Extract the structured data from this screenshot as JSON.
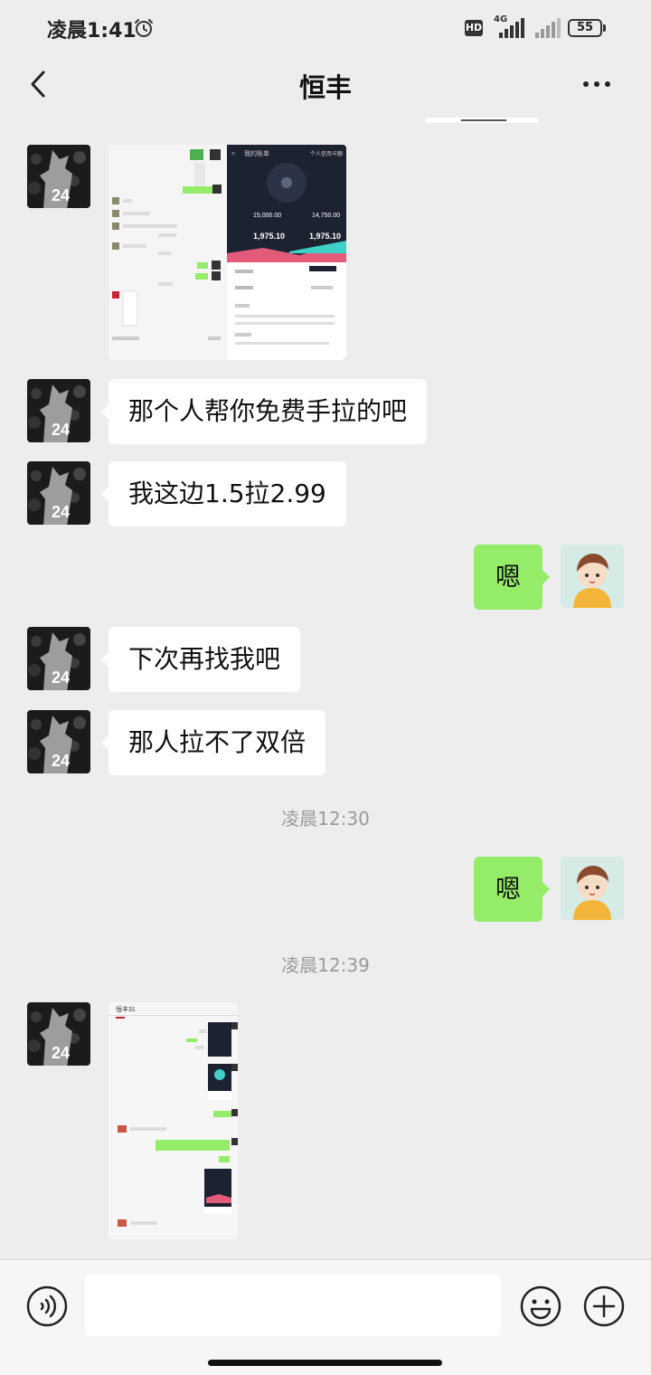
{
  "status_bar": {
    "time": "凌晨1:41",
    "hd": "HD",
    "network": "4G",
    "battery": "55"
  },
  "chat": {
    "title": "恒丰"
  },
  "messages": {
    "m2": "那个人帮你免费手拉的吧",
    "m3": "我这边1.5拉2.99",
    "m4": "嗯",
    "m5": "下次再找我吧",
    "m6": "那人拉不了双倍",
    "t1": "凌晨12:30",
    "m7": "嗯",
    "t2": "凌晨12:39"
  },
  "thumb1": {
    "left_title": "我的账单",
    "right_header": "个人信用卡额",
    "amount1": "15,000.00",
    "amount2": "14,750.00",
    "amount3": "1,975.10",
    "amount4": "1,975.10"
  },
  "thumb2": {
    "title": "恒丰31"
  },
  "icons": {
    "alarm": "alarm-clock-icon",
    "back": "chevron-left-icon",
    "more": "more-dots-icon",
    "voice": "voice-icon",
    "emoji": "emoji-icon",
    "plus": "plus-icon"
  },
  "colors": {
    "background": "#ededed",
    "incoming_bubble": "#ffffff",
    "outgoing_bubble": "#95ec69",
    "timestamp": "#9a9a9a"
  }
}
